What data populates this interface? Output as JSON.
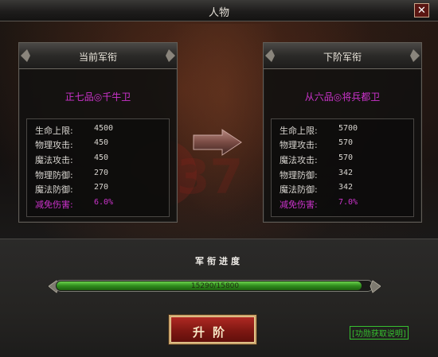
{
  "window": {
    "title": "人物",
    "close_icon": "close-icon"
  },
  "current": {
    "header": "当前军衔",
    "rank": "正七品◎千牛卫",
    "stats": [
      {
        "label": "生命上限:",
        "value": "4500"
      },
      {
        "label": "物理攻击:",
        "value": "450"
      },
      {
        "label": "魔法攻击:",
        "value": "450"
      },
      {
        "label": "物理防御:",
        "value": "270"
      },
      {
        "label": "魔法防御:",
        "value": "270"
      },
      {
        "label": "减免伤害:",
        "value": "6.0%"
      }
    ]
  },
  "next": {
    "header": "下阶军衔",
    "rank": "从六品◎将兵都卫",
    "stats": [
      {
        "label": "生命上限:",
        "value": "5700"
      },
      {
        "label": "物理攻击:",
        "value": "570"
      },
      {
        "label": "魔法攻击:",
        "value": "570"
      },
      {
        "label": "物理防御:",
        "value": "342"
      },
      {
        "label": "魔法防御:",
        "value": "342"
      },
      {
        "label": "减免伤害:",
        "value": "7.0%"
      }
    ]
  },
  "progress": {
    "title": "军衔进度",
    "text": "15290/15800",
    "current": 15290,
    "max": 15800
  },
  "actions": {
    "upgrade_label": "升阶",
    "help_label": "[功勋获取说明]"
  },
  "colors": {
    "accent_purple": "#cc33cc",
    "progress_green": "#3aa522",
    "button_red": "#8a1d17",
    "link_green": "#36c12f"
  }
}
